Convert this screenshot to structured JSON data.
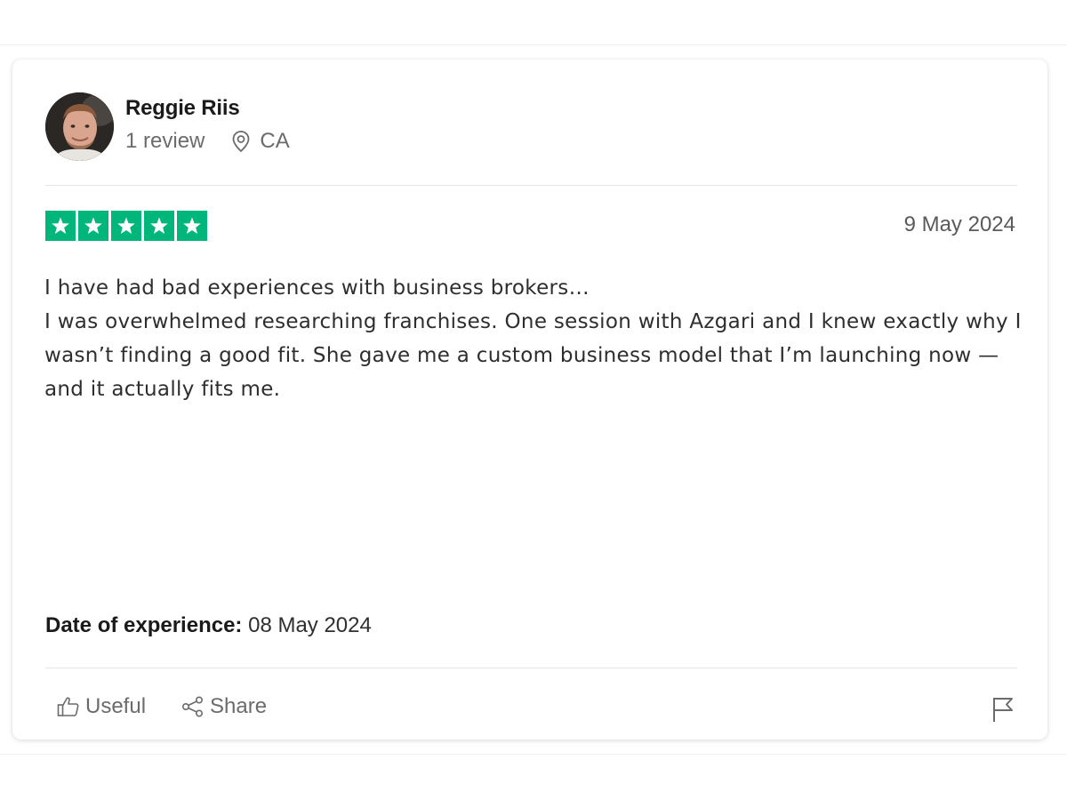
{
  "reviewer": {
    "name": "Reggie Riis",
    "review_count": "1 review",
    "location": "CA",
    "avatar_icon": "avatar-photo"
  },
  "rating": {
    "stars": 5,
    "max_stars": 5,
    "color": "#00b67a"
  },
  "review": {
    "date": "9 May 2024",
    "paragraphs": [
      "I have had bad experiences with business brokers…",
      "I was overwhelmed researching franchises. One session with Azgari and I knew exactly why I wasn’t finding a good fit. She gave me a custom business model that I’m launching now — and it actually fits me."
    ]
  },
  "experience": {
    "label": "Date of experience:",
    "value": " 08 May 2024"
  },
  "actions": {
    "useful_label": "Useful",
    "share_label": "Share",
    "useful_icon": "thumbs-up-icon",
    "share_icon": "share-icon",
    "flag_icon": "flag-icon"
  }
}
